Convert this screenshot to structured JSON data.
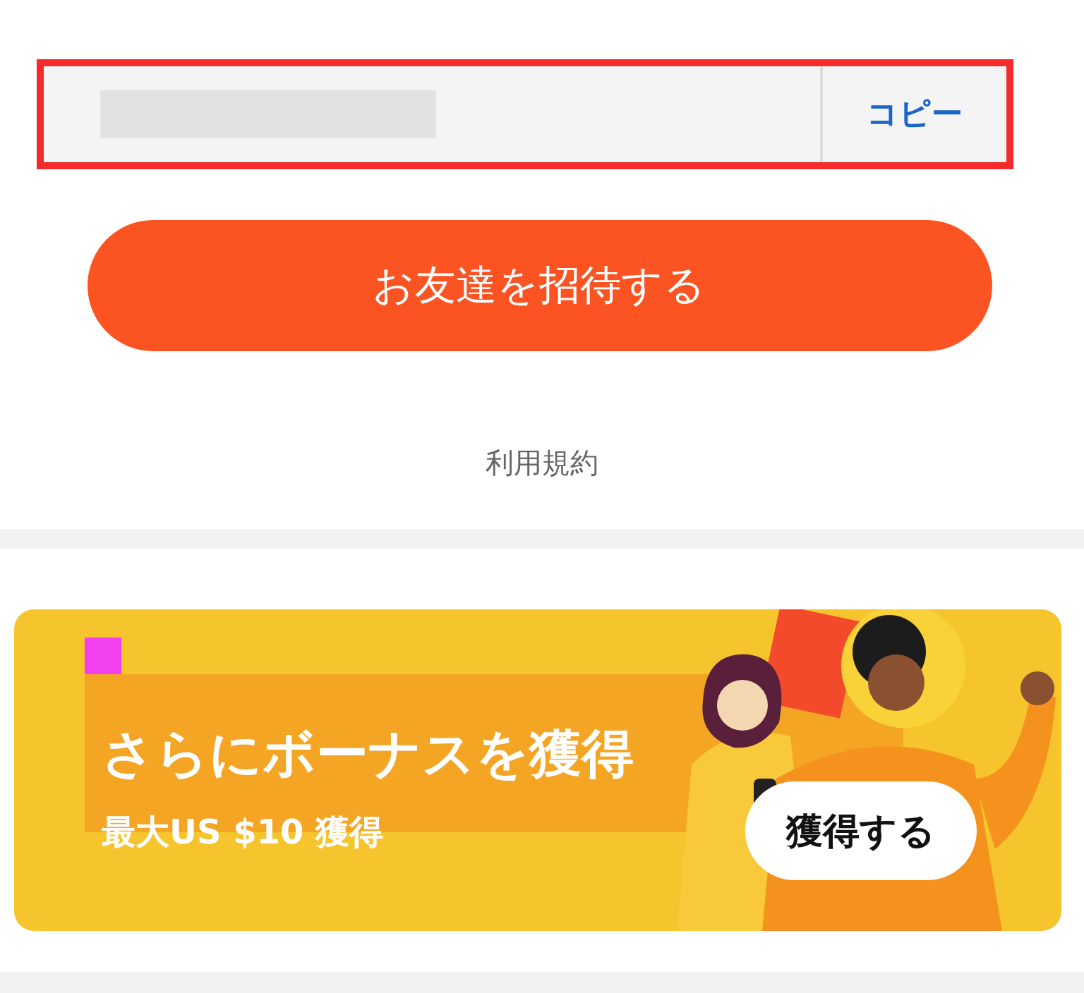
{
  "invite_link": {
    "copy_button": "コピー"
  },
  "invite_button": "お友達を招待する",
  "terms_link": "利用規約",
  "bonus_banner": {
    "title": "さらにボーナスを獲得",
    "subtitle": "最大US $10 獲得",
    "button": "獲得する"
  }
}
